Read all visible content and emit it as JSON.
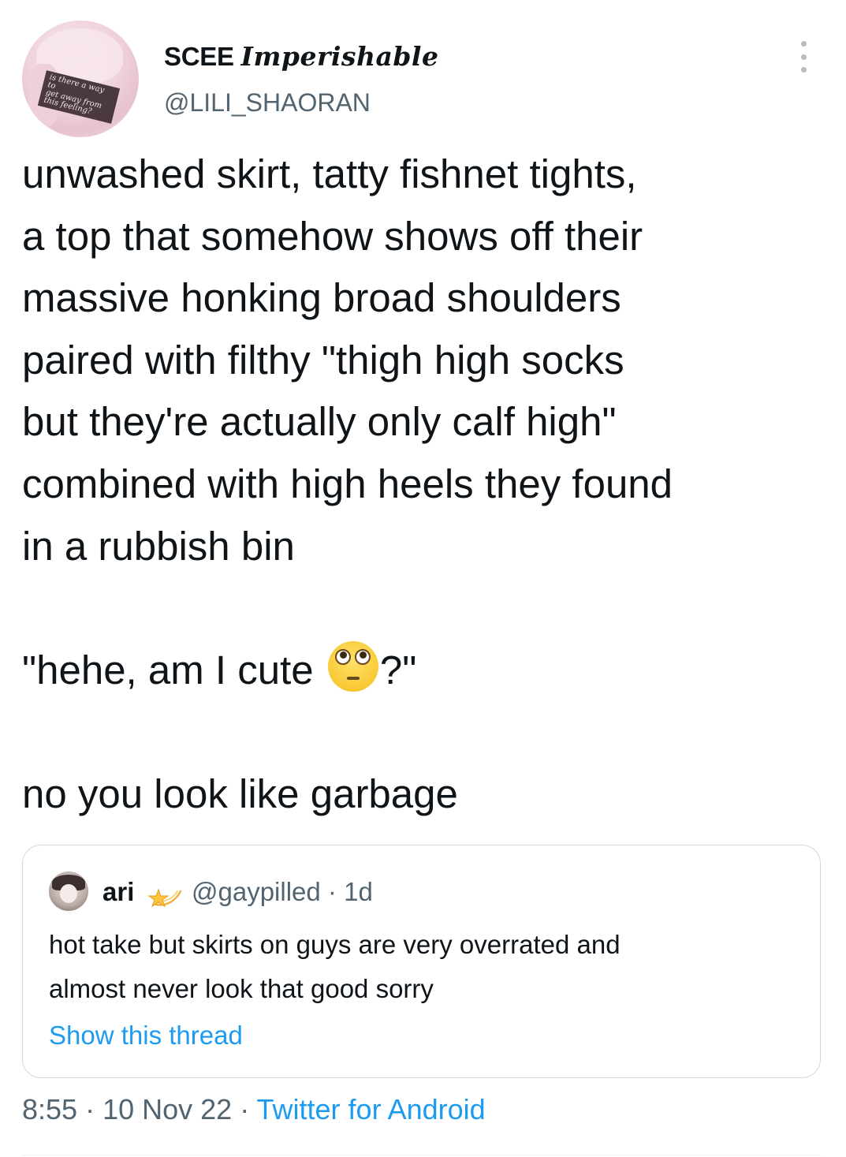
{
  "author": {
    "display_name_plain": "SCEE",
    "display_name_fancy": "Imperishable",
    "handle": "@LILI_SHAORAN",
    "avatar_caption": "is there a way to\nget away from\nthis feeling?"
  },
  "tweet": {
    "lines": [
      "unwashed skirt, tatty fishnet tights,",
      "a top that somehow shows off their",
      "massive honking broad shoulders",
      "paired with filthy \"thigh high socks",
      "but they're actually only calf high\"",
      "combined with high heels they found",
      "in a rubbish bin"
    ],
    "quote_line_before_emoji": "\"hehe, am I cute ",
    "quote_line_after_emoji": "?\"",
    "emoji": "pleading-face-icon",
    "last_line": "no you look like garbage"
  },
  "quoted_tweet": {
    "name": "ari",
    "name_icon": "shooting-star-icon",
    "handle_and_time": "@gaypilled · 1d",
    "lines": [
      "hot take but skirts on guys are very overrated and",
      "almost never look that good sorry"
    ],
    "show_thread": "Show this thread"
  },
  "footer": {
    "time": "8:55",
    "date": "10 Nov 22",
    "separator": " · ",
    "source": "Twitter for Android"
  },
  "colors": {
    "text": "#0f1419",
    "secondary": "#536471",
    "link": "#1d9bf0",
    "border": "#cfd9de"
  }
}
